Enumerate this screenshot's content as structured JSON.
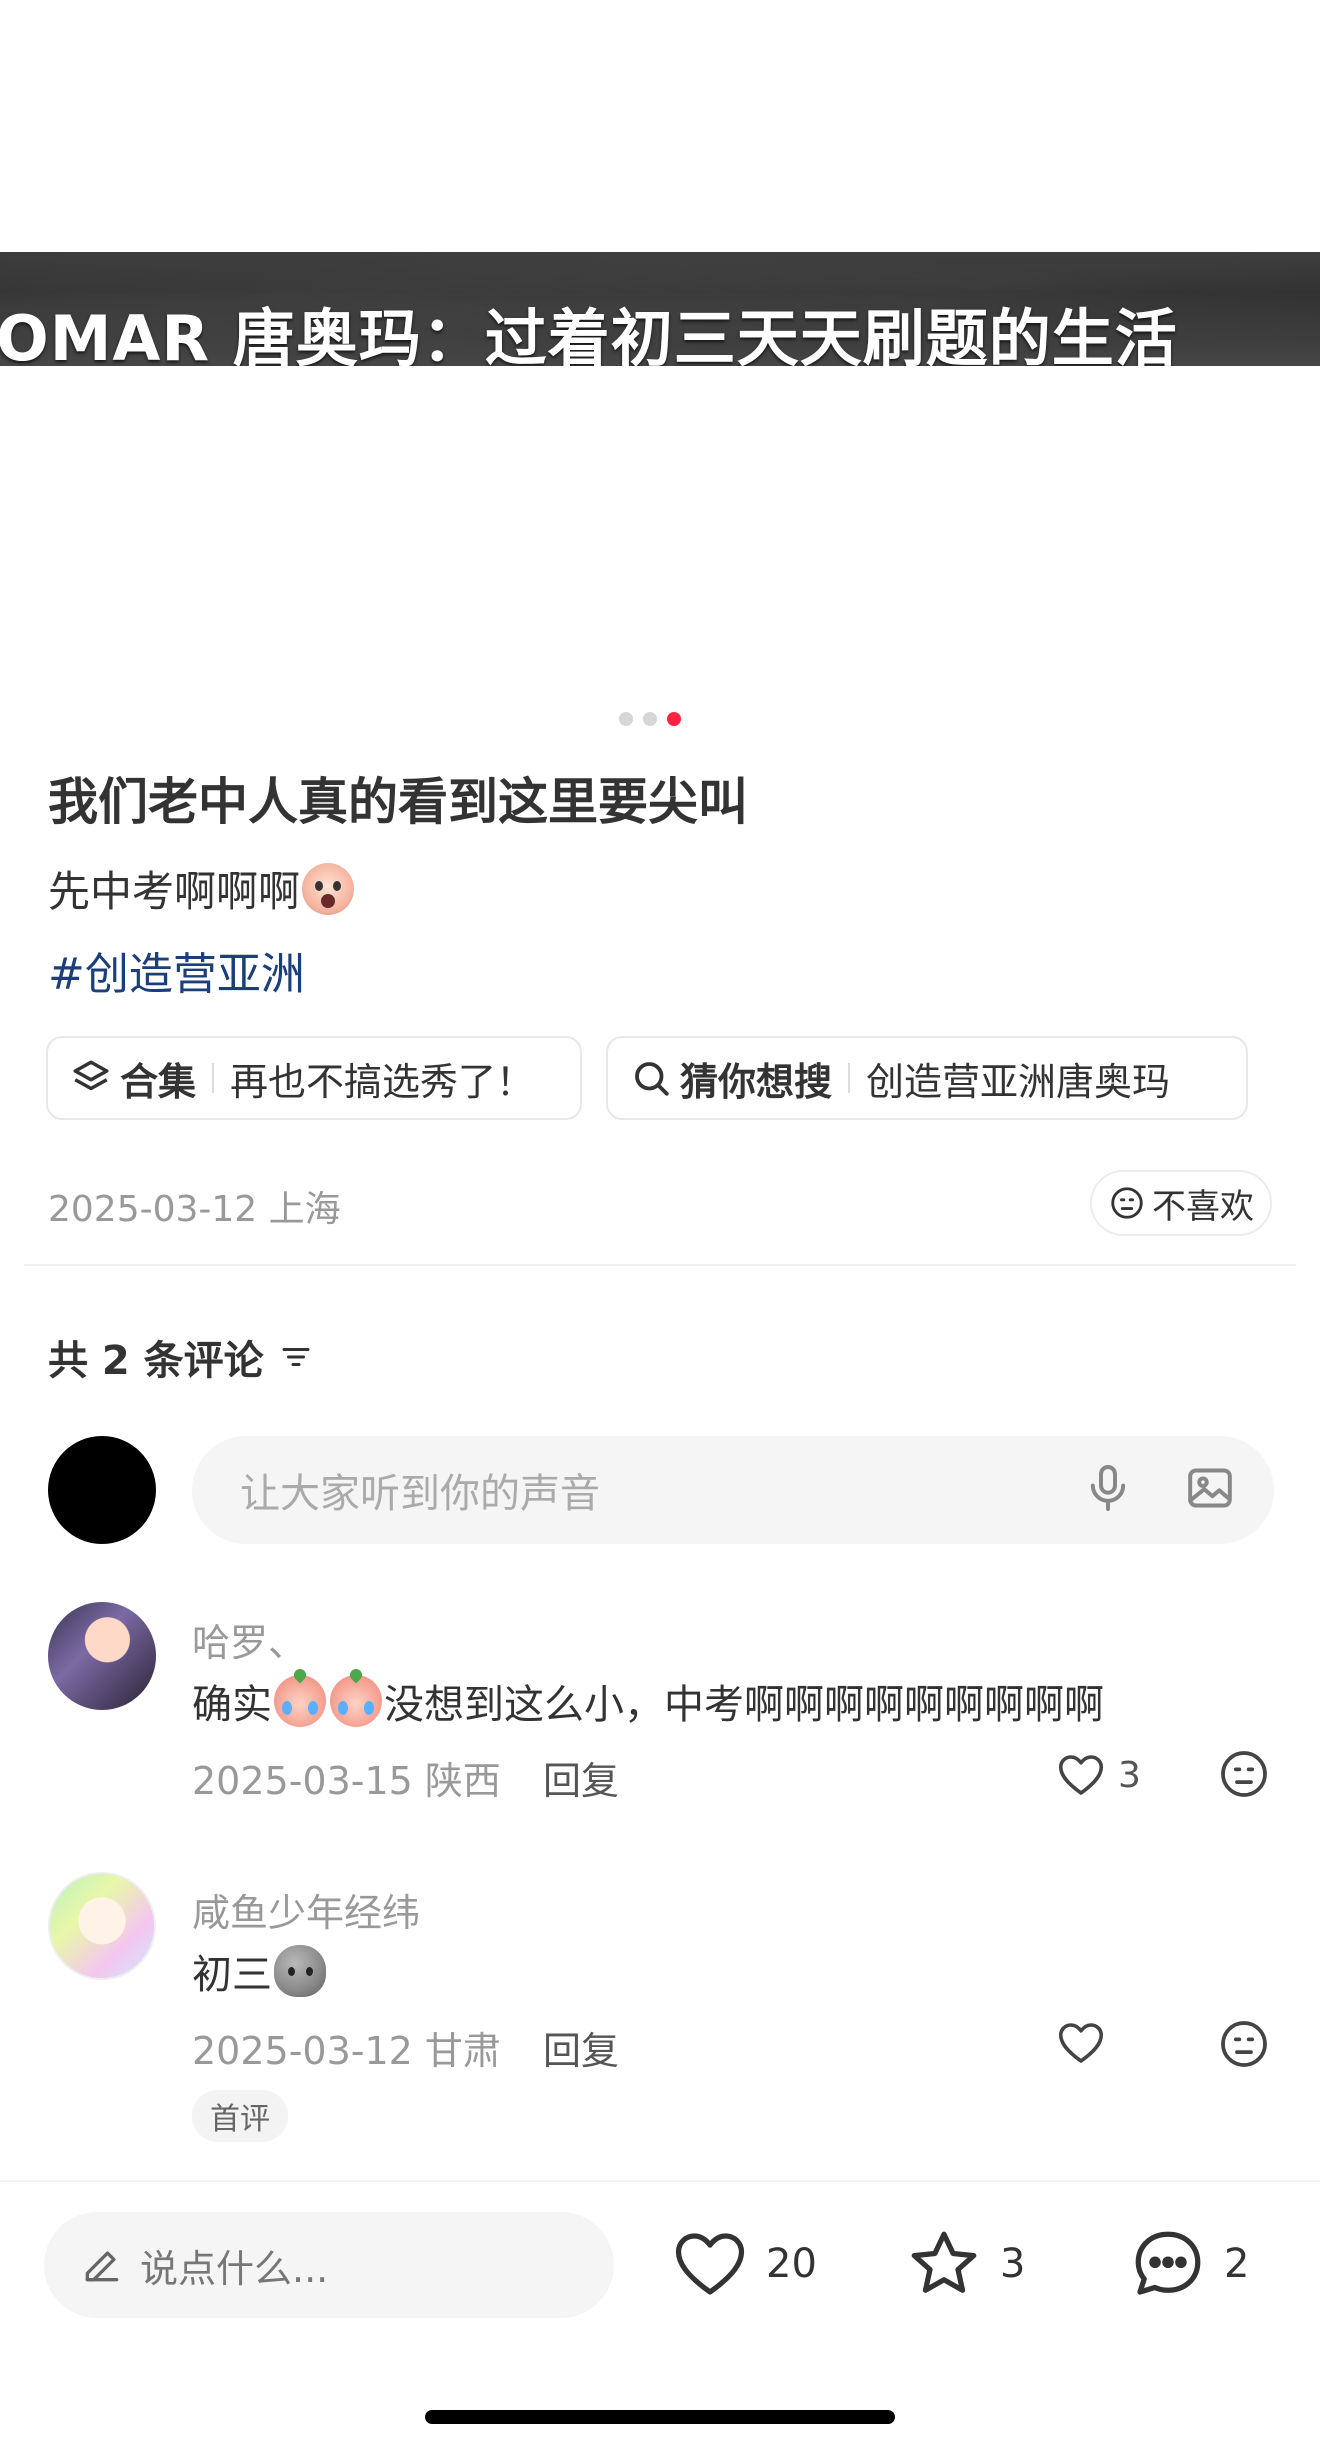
{
  "banner": {
    "text": "OMAR 唐奥玛：过着初三天天刷题的生活"
  },
  "carousel": {
    "total": 3,
    "active_index": 2
  },
  "post": {
    "title": "我们老中人真的看到这里要尖叫",
    "description": "先中考啊啊啊",
    "description_emoji": "screaming-face-emoji",
    "hashtag": "#创造营亚洲"
  },
  "chips": [
    {
      "icon": "layers-icon",
      "label": "合集",
      "value": "再也不搞选秀了！"
    },
    {
      "icon": "search-icon",
      "label": "猜你想搜",
      "value": "创造营亚洲唐奥玛"
    }
  ],
  "meta": {
    "date_location": "2025-03-12 上海",
    "dislike_label": "不喜欢"
  },
  "comments_section": {
    "header": "共 2 条评论",
    "input_placeholder": "让大家听到你的声音"
  },
  "comments": [
    {
      "name": "哈罗、",
      "text_before": "确实",
      "text_after": "没想到这么小，中考啊啊啊啊啊啊啊啊啊",
      "date_location": "2025-03-15 陕西",
      "reply_label": "回复",
      "likes": "3"
    },
    {
      "name": "咸鱼少年经纬",
      "text_before": "初三",
      "date_location": "2025-03-12 甘肃",
      "reply_label": "回复",
      "badge": "首评"
    }
  ],
  "bottom_bar": {
    "input_placeholder": "说点什么...",
    "likes": "20",
    "stars": "3",
    "comments": "2"
  },
  "colors": {
    "accent": "#ff2442",
    "hashtag": "#1b3f7a"
  }
}
